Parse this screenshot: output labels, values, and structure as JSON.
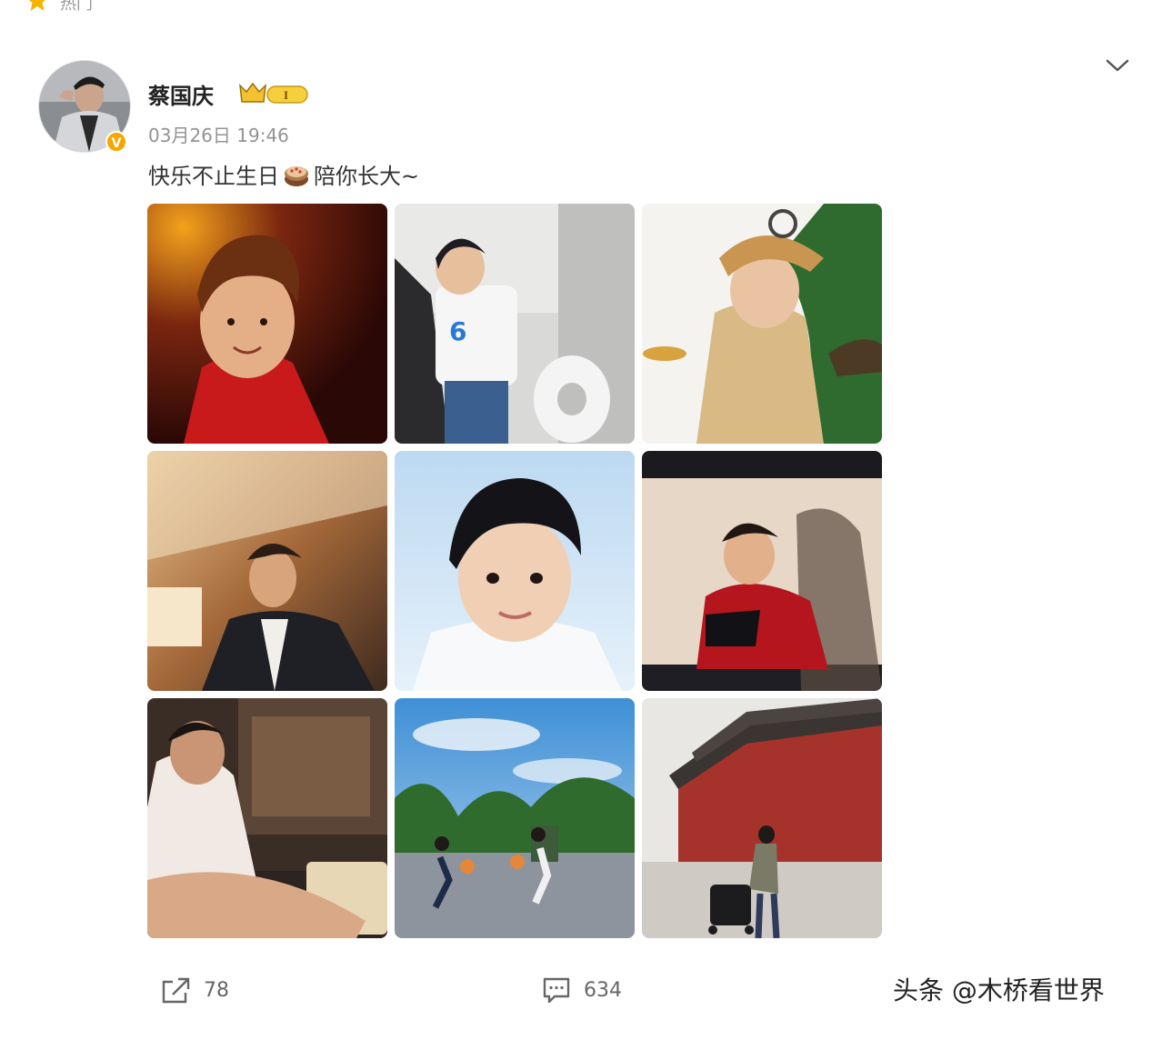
{
  "top_bar": {
    "label": "热门"
  },
  "post": {
    "username": "蔡国庆",
    "vip_level": "I",
    "timestamp": "03月26日 19:46",
    "text_before": "快乐不止生日",
    "text_after": "陪你长大~",
    "emoji": "cake-icon",
    "photos": [
      {
        "name": "photo-1"
      },
      {
        "name": "photo-2"
      },
      {
        "name": "photo-3"
      },
      {
        "name": "photo-4"
      },
      {
        "name": "photo-5"
      },
      {
        "name": "photo-6"
      },
      {
        "name": "photo-7"
      },
      {
        "name": "photo-8"
      },
      {
        "name": "photo-9"
      }
    ]
  },
  "actions": {
    "share_count": "78",
    "comment_count": "634"
  },
  "watermark": "头条 @木桥看世界",
  "colors": {
    "accent": "#f7a600",
    "text": "#333333",
    "muted": "#939393"
  }
}
